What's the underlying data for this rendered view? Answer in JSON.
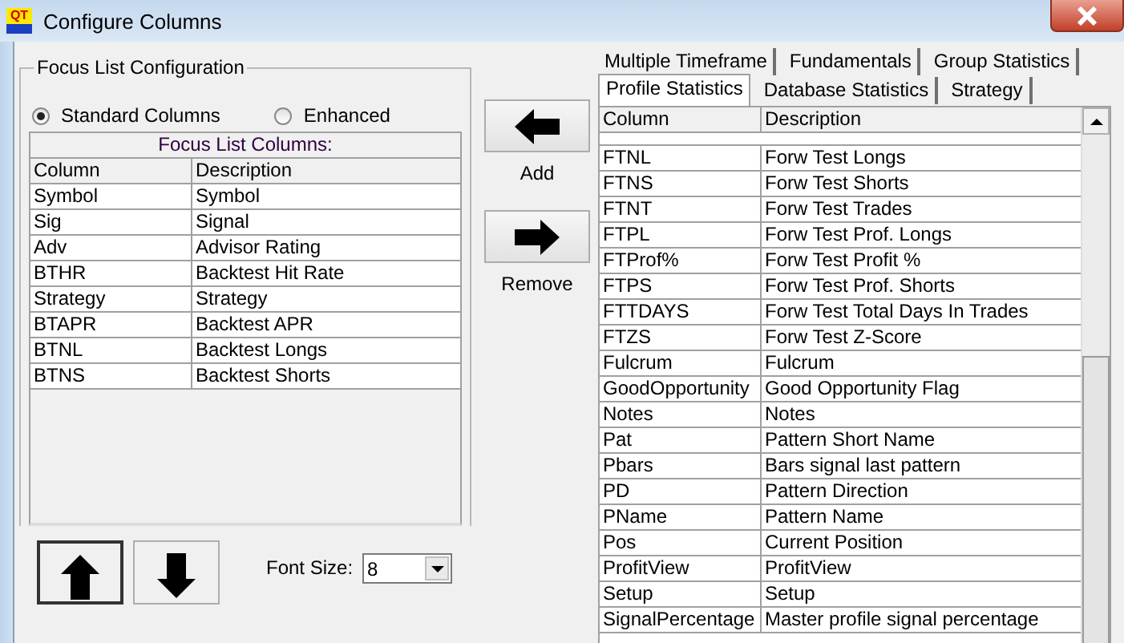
{
  "window": {
    "title": "Configure Columns",
    "logo": "QT"
  },
  "focus_list": {
    "title": "Focus List Configuration",
    "modes": [
      {
        "label": "Standard Columns",
        "selected": true
      },
      {
        "label": "Enhanced",
        "selected": false
      }
    ],
    "table": {
      "caption": "Focus List Columns:",
      "columns": [
        "Column",
        "Description"
      ],
      "rows": [
        [
          "Symbol",
          "Symbol"
        ],
        [
          "Sig",
          "Signal"
        ],
        [
          "Adv",
          "Advisor Rating"
        ],
        [
          "BTHR",
          "Backtest Hit Rate"
        ],
        [
          "Strategy",
          "Strategy"
        ],
        [
          "BTAPR",
          "Backtest APR"
        ],
        [
          "BTNL",
          "Backtest Longs"
        ],
        [
          "BTNS",
          "Backtest Shorts"
        ]
      ]
    }
  },
  "buttons": [
    {
      "label": "Add",
      "kind": "left"
    },
    {
      "label": "Remove",
      "kind": "right"
    }
  ],
  "order_buttons": [
    {
      "kind": "up"
    },
    {
      "kind": "down"
    }
  ],
  "font_size": {
    "label": "Font Size:",
    "value": "8"
  },
  "tab_rows": [
    {
      "tabs": [
        {
          "label": "Multiple Timeframe",
          "selected": false
        },
        {
          "label": "Fundamentals",
          "selected": false
        },
        {
          "label": "Group Statistics",
          "selected": false
        }
      ]
    },
    {
      "tabs": [
        {
          "label": "Profile Statistics",
          "selected": true
        },
        {
          "label": "Database Statistics",
          "selected": false
        },
        {
          "label": "Strategy",
          "selected": false
        }
      ]
    }
  ],
  "available": {
    "columns": [
      "Column",
      "Description"
    ],
    "rows": [
      [
        "FTNL",
        "Forw Test Longs"
      ],
      [
        "FTNS",
        "Forw Test Shorts"
      ],
      [
        "FTNT",
        "Forw Test Trades"
      ],
      [
        "FTPL",
        "Forw Test Prof. Longs"
      ],
      [
        "FTProf%",
        "Forw Test Profit %"
      ],
      [
        "FTPS",
        "Forw Test Prof. Shorts"
      ],
      [
        "FTTDAYS",
        "Forw Test Total Days In Trades"
      ],
      [
        "FTZS",
        "Forw Test Z-Score"
      ],
      [
        "Fulcrum",
        "Fulcrum"
      ],
      [
        "GoodOpportunity",
        "Good Opportunity Flag"
      ],
      [
        "Notes",
        "Notes"
      ],
      [
        "Pat",
        "Pattern Short Name"
      ],
      [
        "Pbars",
        "Bars signal last pattern"
      ],
      [
        "PD",
        "Pattern Direction"
      ],
      [
        "PName",
        "Pattern Name"
      ],
      [
        "Pos",
        "Current Position"
      ],
      [
        "ProfitView",
        "ProfitView"
      ],
      [
        "Setup",
        "Setup"
      ],
      [
        "SignalPercentage",
        "Master profile signal percentage"
      ]
    ]
  }
}
